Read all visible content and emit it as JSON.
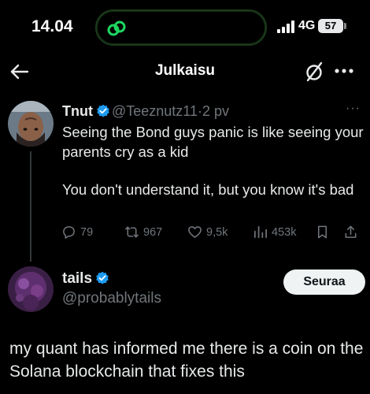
{
  "status_bar": {
    "time": "14.04",
    "network": "4G",
    "battery": "57",
    "island_icon": "link-icon",
    "island_color": "#1ed760"
  },
  "header": {
    "title": "Julkaisu",
    "back_icon": "back-arrow-icon",
    "edit_icon": "compose-slash-icon",
    "more_icon": "more-icon"
  },
  "quoted_tweet": {
    "author_name": "Tnut",
    "handle": "@Teeznutz11",
    "separator": "·",
    "time": "2 pv",
    "text_line1": "Seeing the Bond guys panic is like seeing your parents cry as a kid",
    "text_line2": "You don't understand it, but you know it's bad",
    "replies": "79",
    "reposts": "967",
    "likes": "9,5k",
    "views": "453k"
  },
  "tweet": {
    "author_name": "tails",
    "handle": "@probablytails",
    "follow_label": "Seuraa",
    "text": "my quant has informed me there is a coin on the Solana blockchain that fixes this"
  },
  "colors": {
    "background": "#000000",
    "verified": "#1d9bf0",
    "muted": "#71767b",
    "text": "#e7e9ea"
  }
}
